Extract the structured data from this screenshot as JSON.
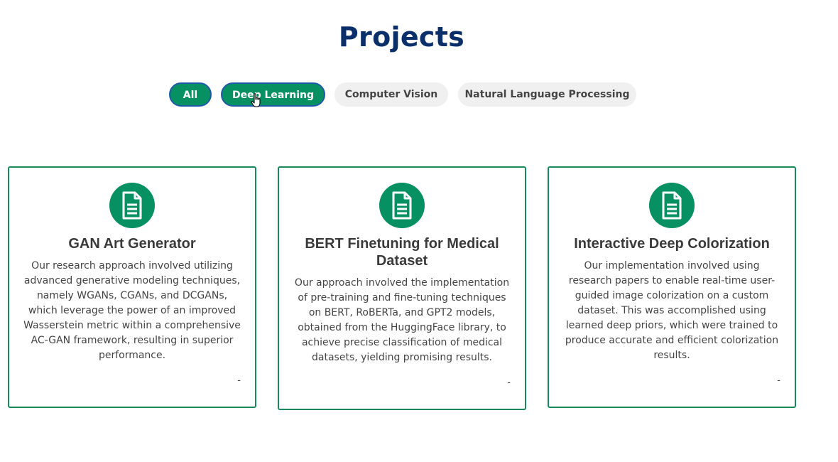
{
  "section": {
    "title": "Projects"
  },
  "filters": [
    {
      "label": "All",
      "active": true
    },
    {
      "label": "Deep Learning",
      "active": true
    },
    {
      "label": "Computer Vision",
      "active": false
    },
    {
      "label": "Natural Language Processing",
      "active": false
    }
  ],
  "cards": [
    {
      "icon": "document-icon",
      "title": "GAN Art Generator",
      "description": "Our research approach involved utilizing advanced generative modeling techniques, namely WGANs, CGANs, and DCGANs, which leverage the power of an improved Wasserstein metric within a comprehensive AC-GAN framework, resulting in superior performance.",
      "footer": "-"
    },
    {
      "icon": "document-icon",
      "title": "BERT Finetuning for Medical Dataset",
      "description": "Our approach involved the implementation of pre-training and fine-tuning techniques on BERT, RoBERTa, and GPT2 models, obtained from the HuggingFace library, to achieve precise classification of medical datasets, yielding promising results.",
      "footer": "-"
    },
    {
      "icon": "document-icon",
      "title": "Interactive Deep Colorization",
      "description": "Our implementation involved using research papers to enable real-time user-guided image colorization on a custom dataset. This was accomplished using learned deep priors, which were trained to produce accurate and efficient colorization results.",
      "footer": "-"
    }
  ],
  "colors": {
    "accent": "#079062",
    "title": "#0b2f6b",
    "card_border": "#1b8a5a"
  }
}
